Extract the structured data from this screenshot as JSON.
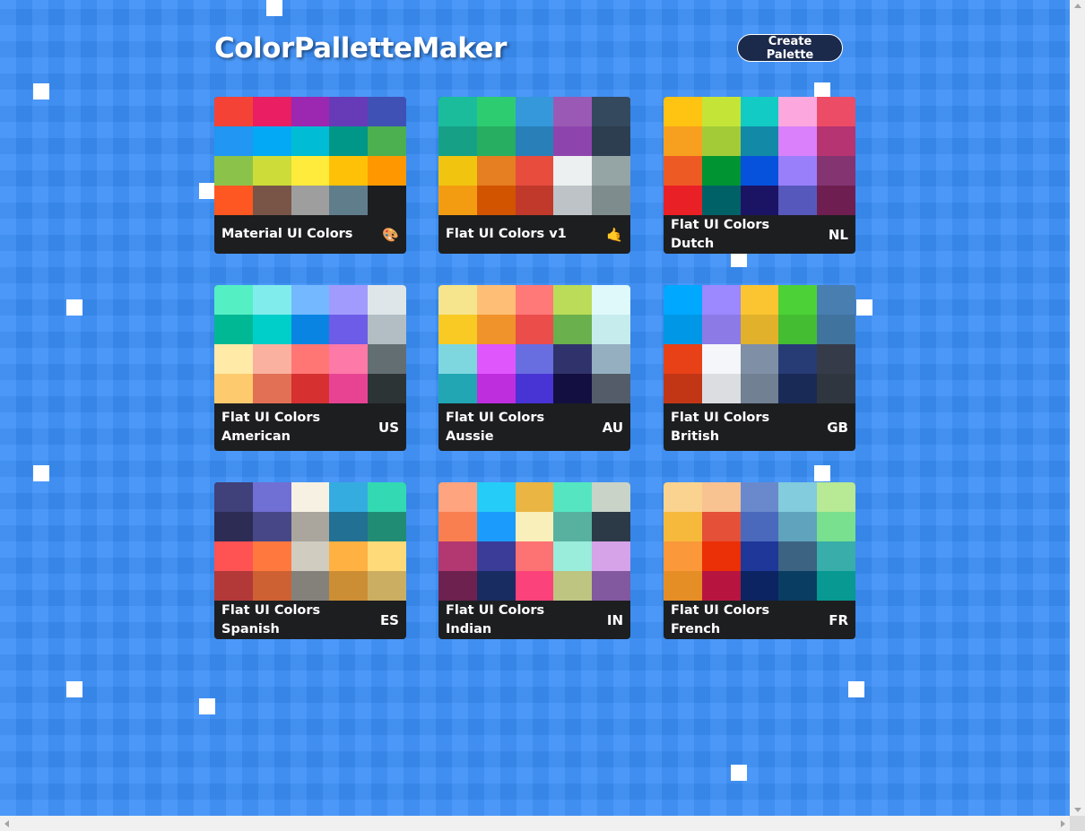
{
  "app": {
    "title": "ColorPalletteMaker",
    "create_button_label": "Create Palette"
  },
  "palettes": [
    {
      "name": "Material UI Colors",
      "emoji": "🎨",
      "colors": [
        "#f44336",
        "#e91e63",
        "#9c27b0",
        "#673ab7",
        "#3f51b5",
        "#2196f3",
        "#03a9f4",
        "#00bcd4",
        "#009688",
        "#4caf50",
        "#8bc34a",
        "#cddc39",
        "#ffeb3b",
        "#ffc107",
        "#ff9800",
        "#ff5722",
        "#795548",
        "#9e9e9e",
        "#607d8b",
        "#1d1e20"
      ]
    },
    {
      "name": "Flat UI Colors v1",
      "emoji": "🤙",
      "colors": [
        "#1abc9c",
        "#2ecc71",
        "#3498db",
        "#9b59b6",
        "#34495e",
        "#16a085",
        "#27ae60",
        "#2980b9",
        "#8e44ad",
        "#2c3e50",
        "#f1c40f",
        "#e67e22",
        "#e74c3c",
        "#ecf0f1",
        "#95a5a6",
        "#f39c12",
        "#d35400",
        "#c0392b",
        "#bdc3c7",
        "#7f8c8d"
      ]
    },
    {
      "name": "Flat UI Colors Dutch",
      "emoji": "NL",
      "colors": [
        "#ffc312",
        "#c4e538",
        "#12cbc4",
        "#fda7df",
        "#ed4c67",
        "#f79f1f",
        "#a3cb38",
        "#1289a7",
        "#d980fa",
        "#b53471",
        "#ee5a24",
        "#009432",
        "#0652dd",
        "#9980fa",
        "#833471",
        "#ea2027",
        "#006266",
        "#1b1464",
        "#5758bb",
        "#6f1e51"
      ]
    },
    {
      "name": "Flat UI Colors American",
      "emoji": "US",
      "colors": [
        "#55efc4",
        "#81ecec",
        "#74b9ff",
        "#a29bfe",
        "#dfe6e9",
        "#00b894",
        "#00cec9",
        "#0984e3",
        "#6c5ce7",
        "#b2bec3",
        "#ffeaa7",
        "#fab1a0",
        "#ff7675",
        "#fd79a8",
        "#636e72",
        "#fdcb6e",
        "#e17055",
        "#d63031",
        "#e84393",
        "#2d3436"
      ]
    },
    {
      "name": "Flat UI Colors Aussie",
      "emoji": "AU",
      "colors": [
        "#f6e58d",
        "#ffbe76",
        "#ff7979",
        "#badc58",
        "#dff9fb",
        "#f9ca24",
        "#f0932b",
        "#eb4d4b",
        "#6ab04c",
        "#c7ecee",
        "#7ed6df",
        "#e056fd",
        "#686de0",
        "#30336b",
        "#95afc0",
        "#22a6b3",
        "#be2edd",
        "#4834d4",
        "#130f40",
        "#535c68"
      ]
    },
    {
      "name": "Flat UI Colors British",
      "emoji": "GB",
      "colors": [
        "#00a8ff",
        "#9c88ff",
        "#fbc531",
        "#4cd137",
        "#487eb0",
        "#0097e6",
        "#8c7ae6",
        "#e1b12c",
        "#44bd32",
        "#40739e",
        "#e84118",
        "#f5f6fa",
        "#7f8fa6",
        "#273c75",
        "#353b48",
        "#c23616",
        "#dcdde1",
        "#718093",
        "#192a56",
        "#2f3640"
      ]
    },
    {
      "name": "Flat UI Colors Spanish",
      "emoji": "ES",
      "colors": [
        "#40407a",
        "#706fd3",
        "#f7f1e3",
        "#34ace0",
        "#33d9b2",
        "#2c2c54",
        "#474787",
        "#aaa69d",
        "#227093",
        "#218c74",
        "#ff5252",
        "#ff793f",
        "#d1ccc0",
        "#ffb142",
        "#ffda79",
        "#b33939",
        "#cd6133",
        "#84817a",
        "#cc8e35",
        "#ccae62"
      ]
    },
    {
      "name": "Flat UI Colors Indian",
      "emoji": "IN",
      "colors": [
        "#fea47f",
        "#25ccf7",
        "#eab543",
        "#55e6c1",
        "#cad3c8",
        "#f97f51",
        "#1b9cfc",
        "#f8efba",
        "#58b19f",
        "#2c3a47",
        "#b33771",
        "#3b3b98",
        "#fd7272",
        "#9aecdb",
        "#d6a2e8",
        "#6d214f",
        "#182c61",
        "#fc427b",
        "#bdc581",
        "#82589f"
      ]
    },
    {
      "name": "Flat UI Colors French",
      "emoji": "FR",
      "colors": [
        "#fad390",
        "#f8c291",
        "#6a89cc",
        "#82ccdd",
        "#b8e994",
        "#f6b93b",
        "#e55039",
        "#4a69bd",
        "#60a3bc",
        "#78e08f",
        "#fa983a",
        "#eb2f06",
        "#1e3799",
        "#3c6382",
        "#38ada9",
        "#e58e26",
        "#b71540",
        "#0c2461",
        "#0a3d62",
        "#079992"
      ]
    }
  ]
}
